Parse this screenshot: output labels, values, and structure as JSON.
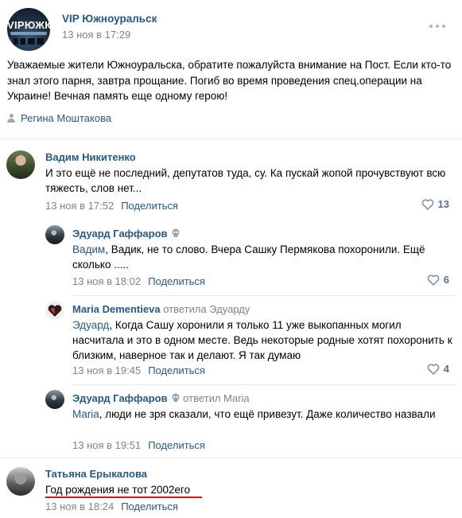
{
  "post": {
    "group_name": "VIP Южноуральск",
    "time": "13 ноя в 17:29",
    "avatar_logo": "VIPЮЖК",
    "text": "Уважаемые жители Южноуральска, обратите пожалуйста внимание на Пост. Если кто-то знал этого парня, завтра прощание. Погиб во время проведения спец.операции на Украине! Вечная память еще одному герою!",
    "author": "Регина Моштакова",
    "more_icon": "more-dots-icon",
    "author_icon": "person-icon"
  },
  "share_label": "Поделиться",
  "comments": [
    {
      "name": "Вадим Никитенко",
      "text": "И это ещё не последний, депутатов туда, су. Ка пускай жопой прочувствуют всю тяжесть, слов нет...",
      "time": "13 ноя в 17:52",
      "likes": "13"
    },
    {
      "name": "Эдуард Гаффаров",
      "addressee": "Вадим",
      "text": ", Вадик, не то слово. Вчера Сашку Пермякова похоронили. Ещё сколько .....",
      "time": "13 ноя в 18:02",
      "likes": "6"
    },
    {
      "name": "Maria Dementieva",
      "replied_to": "ответила Эдуарду",
      "addressee": "Эдуард",
      "text": ", Когда Сашу хоронили я только 11 уже выкопанных могил насчитала и это в одном месте. Ведь некоторые родные хотят похоронить к близким, наверное так и делают. Я так думаю",
      "time": "13 ноя в 19:45",
      "likes": "4"
    },
    {
      "name": "Эдуард Гаффаров",
      "replied_to": "ответил Maria",
      "addressee": "Maria",
      "text": ", люди не зря сказали, что ещё привезут. Даже количество назвали",
      "time": "13 ноя в 19:51"
    },
    {
      "name": "Татьяна Ерыкалова",
      "text": "Год рождения не тот 2002его",
      "time": "13 ноя в 18:24"
    }
  ],
  "colors": {
    "link": "#2a5885",
    "meta": "#828282",
    "underline": "#e00000"
  }
}
